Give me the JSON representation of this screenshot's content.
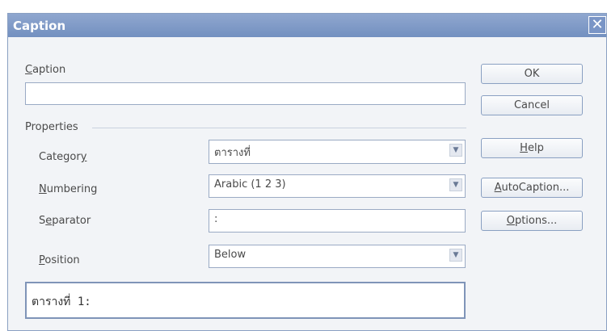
{
  "window": {
    "title": "Caption",
    "close_glyph": "✕"
  },
  "caption": {
    "label_u": "C",
    "label_rest": "aption",
    "value": ""
  },
  "properties": {
    "label": "Properties"
  },
  "category": {
    "label_pre": "Categor",
    "label_u": "y",
    "label_post": "",
    "value": "ตารางที่",
    "arrow": "▼"
  },
  "numbering": {
    "label_pre": "",
    "label_u": "N",
    "label_post": "umbering",
    "value": "Arabic (1 2 3)",
    "arrow": "▼"
  },
  "separator": {
    "label_pre": "S",
    "label_u": "e",
    "label_post": "parator",
    "value": ":"
  },
  "position": {
    "label_pre": "",
    "label_u": "P",
    "label_post": "osition",
    "value": "Below",
    "arrow": "▼"
  },
  "preview": {
    "text": "ตารางที่ 1:"
  },
  "buttons": {
    "ok": "OK",
    "cancel": "Cancel",
    "help_u": "H",
    "help_rest": "elp",
    "autocaption_u": "A",
    "autocaption_rest": "utoCaption...",
    "options_u": "O",
    "options_rest": "ptions..."
  },
  "colors": {
    "titlebar": "#7f9ac8",
    "dialog_bg": "#f2f4f7",
    "border": "#8aa0c2"
  },
  "icons": {
    "close": "close-icon",
    "dropdown": "chevron-down-icon"
  }
}
